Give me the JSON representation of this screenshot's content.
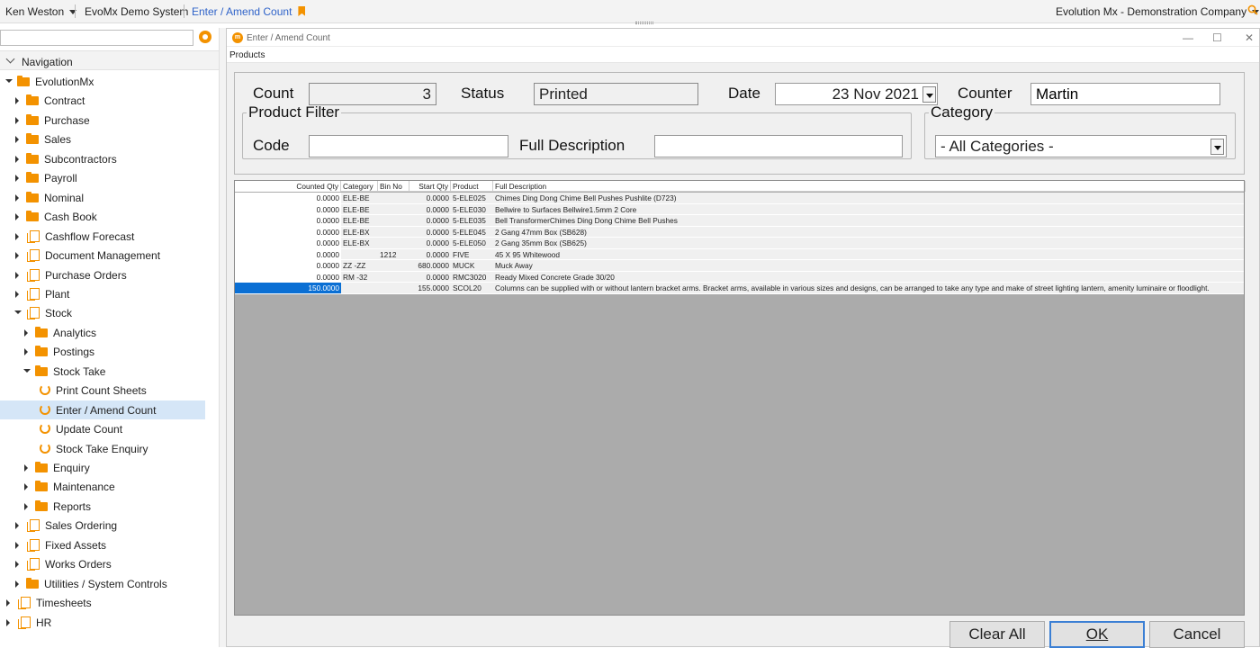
{
  "topbar": {
    "user": "Ken Weston",
    "system": "EvoMx Demo System",
    "screen": "Enter / Amend Count",
    "company": "Evolution Mx - Demonstration Company"
  },
  "sidebar": {
    "search_value": "",
    "nav_header": "Navigation",
    "items": [
      {
        "label": "EvolutionMx",
        "icon": "folder-icon",
        "level": 0,
        "state": "expanded"
      },
      {
        "label": "Contract",
        "icon": "folder-icon",
        "level": 1,
        "state": "collapsed"
      },
      {
        "label": "Purchase",
        "icon": "folder-icon",
        "level": 1,
        "state": "collapsed"
      },
      {
        "label": "Sales",
        "icon": "folder-icon",
        "level": 1,
        "state": "collapsed"
      },
      {
        "label": "Subcontractors",
        "icon": "folder-icon",
        "level": 1,
        "state": "collapsed"
      },
      {
        "label": "Payroll",
        "icon": "folder-icon",
        "level": 1,
        "state": "collapsed"
      },
      {
        "label": "Nominal",
        "icon": "folder-icon",
        "level": 1,
        "state": "collapsed"
      },
      {
        "label": "Cash Book",
        "icon": "folder-icon",
        "level": 1,
        "state": "collapsed"
      },
      {
        "label": "Cashflow Forecast",
        "icon": "module-icon",
        "level": 1,
        "state": "collapsed"
      },
      {
        "label": "Document Management",
        "icon": "module-icon",
        "level": 1,
        "state": "collapsed"
      },
      {
        "label": "Purchase Orders",
        "icon": "module-icon",
        "level": 1,
        "state": "collapsed"
      },
      {
        "label": "Plant",
        "icon": "module-icon",
        "level": 1,
        "state": "collapsed"
      },
      {
        "label": "Stock",
        "icon": "module-icon",
        "level": 1,
        "state": "expanded"
      },
      {
        "label": "Analytics",
        "icon": "folder-icon",
        "level": 2,
        "state": "collapsed"
      },
      {
        "label": "Postings",
        "icon": "folder-icon",
        "level": 2,
        "state": "collapsed"
      },
      {
        "label": "Stock Take",
        "icon": "folder-icon",
        "level": 2,
        "state": "expanded"
      },
      {
        "label": "Print Count Sheets",
        "icon": "screen-icon",
        "level": 3,
        "state": "leaf"
      },
      {
        "label": "Enter / Amend Count",
        "icon": "screen-icon",
        "level": 3,
        "state": "leaf",
        "selected": true
      },
      {
        "label": "Update Count",
        "icon": "screen-icon",
        "level": 3,
        "state": "leaf"
      },
      {
        "label": "Stock Take Enquiry",
        "icon": "screen-icon",
        "level": 3,
        "state": "leaf"
      },
      {
        "label": "Enquiry",
        "icon": "folder-icon",
        "level": 2,
        "state": "collapsed"
      },
      {
        "label": "Maintenance",
        "icon": "folder-icon",
        "level": 2,
        "state": "collapsed"
      },
      {
        "label": "Reports",
        "icon": "folder-icon",
        "level": 2,
        "state": "collapsed"
      },
      {
        "label": "Sales Ordering",
        "icon": "module-icon",
        "level": 1,
        "state": "collapsed"
      },
      {
        "label": "Fixed Assets",
        "icon": "module-icon",
        "level": 1,
        "state": "collapsed"
      },
      {
        "label": "Works Orders",
        "icon": "module-icon",
        "level": 1,
        "state": "collapsed"
      },
      {
        "label": "Utilities / System Controls",
        "icon": "folder-icon",
        "level": 1,
        "state": "collapsed"
      },
      {
        "label": "Timesheets",
        "icon": "module-icon",
        "level": 0,
        "state": "collapsed"
      },
      {
        "label": "HR",
        "icon": "module-icon",
        "level": 0,
        "state": "collapsed"
      }
    ]
  },
  "window": {
    "title": "Enter / Amend Count",
    "logo_text": "m",
    "menu_label": "Products"
  },
  "form": {
    "count_label": "Count",
    "count_value": "3",
    "status_label": "Status",
    "status_value": "Printed",
    "date_label": "Date",
    "date_value": "23 Nov 2021",
    "counter_label": "Counter",
    "counter_value": "Martin",
    "product_filter_legend": "Product Filter",
    "code_label": "Code",
    "code_value": "",
    "full_desc_label": "Full Description",
    "full_desc_value": "",
    "category_legend": "Category",
    "category_value": "- All Categories -"
  },
  "grid": {
    "columns": [
      "Counted Qty",
      "Category",
      "Bin No",
      "Start Qty",
      "Product",
      "Full Description"
    ],
    "rows": [
      {
        "counted": "0.0000",
        "category": "ELE-BE",
        "bin": "",
        "start": "0.0000",
        "product": "5-ELE025",
        "desc": "Chimes Ding Dong Chime Bell Pushes Pushlite (D723)"
      },
      {
        "counted": "0.0000",
        "category": "ELE-BE",
        "bin": "",
        "start": "0.0000",
        "product": "5-ELE030",
        "desc": "Bellwire to Surfaces Bellwire1.5mm 2 Core"
      },
      {
        "counted": "0.0000",
        "category": "ELE-BE",
        "bin": "",
        "start": "0.0000",
        "product": "5-ELE035",
        "desc": "Bell TransformerChimes Ding Dong Chime Bell Pushes"
      },
      {
        "counted": "0.0000",
        "category": "ELE-BX",
        "bin": "",
        "start": "0.0000",
        "product": "5-ELE045",
        "desc": "2 Gang 47mm Box (SB628)"
      },
      {
        "counted": "0.0000",
        "category": "ELE-BX",
        "bin": "",
        "start": "0.0000",
        "product": "5-ELE050",
        "desc": "2 Gang 35mm Box (SB625)"
      },
      {
        "counted": "0.0000",
        "category": "",
        "bin": "1212",
        "start": "0.0000",
        "product": "FIVE",
        "desc": "45 X 95 Whitewood"
      },
      {
        "counted": "0.0000",
        "category": "ZZ -ZZ",
        "bin": "",
        "start": "680.0000",
        "product": "MUCK",
        "desc": "Muck Away"
      },
      {
        "counted": "0.0000",
        "category": "RM -32",
        "bin": "",
        "start": "0.0000",
        "product": "RMC3020",
        "desc": "Ready Mixed Concrete Grade 30/20"
      },
      {
        "counted": "150.0000",
        "category": "",
        "bin": "",
        "start": "155.0000",
        "product": "SCOL20",
        "desc": "Columns can be supplied with or without lantern bracket arms. Bracket arms, available in various sizes and designs, can be arranged to take any type and make of street lighting lantern, amenity luminaire or floodlight.",
        "selected": true
      }
    ]
  },
  "buttons": {
    "clear_all": "Clear All",
    "ok": "OK",
    "cancel": "Cancel"
  },
  "colors": {
    "accent": "#f39200",
    "selection": "#0a6fd4",
    "nav_selected": "#d5e6f7"
  }
}
